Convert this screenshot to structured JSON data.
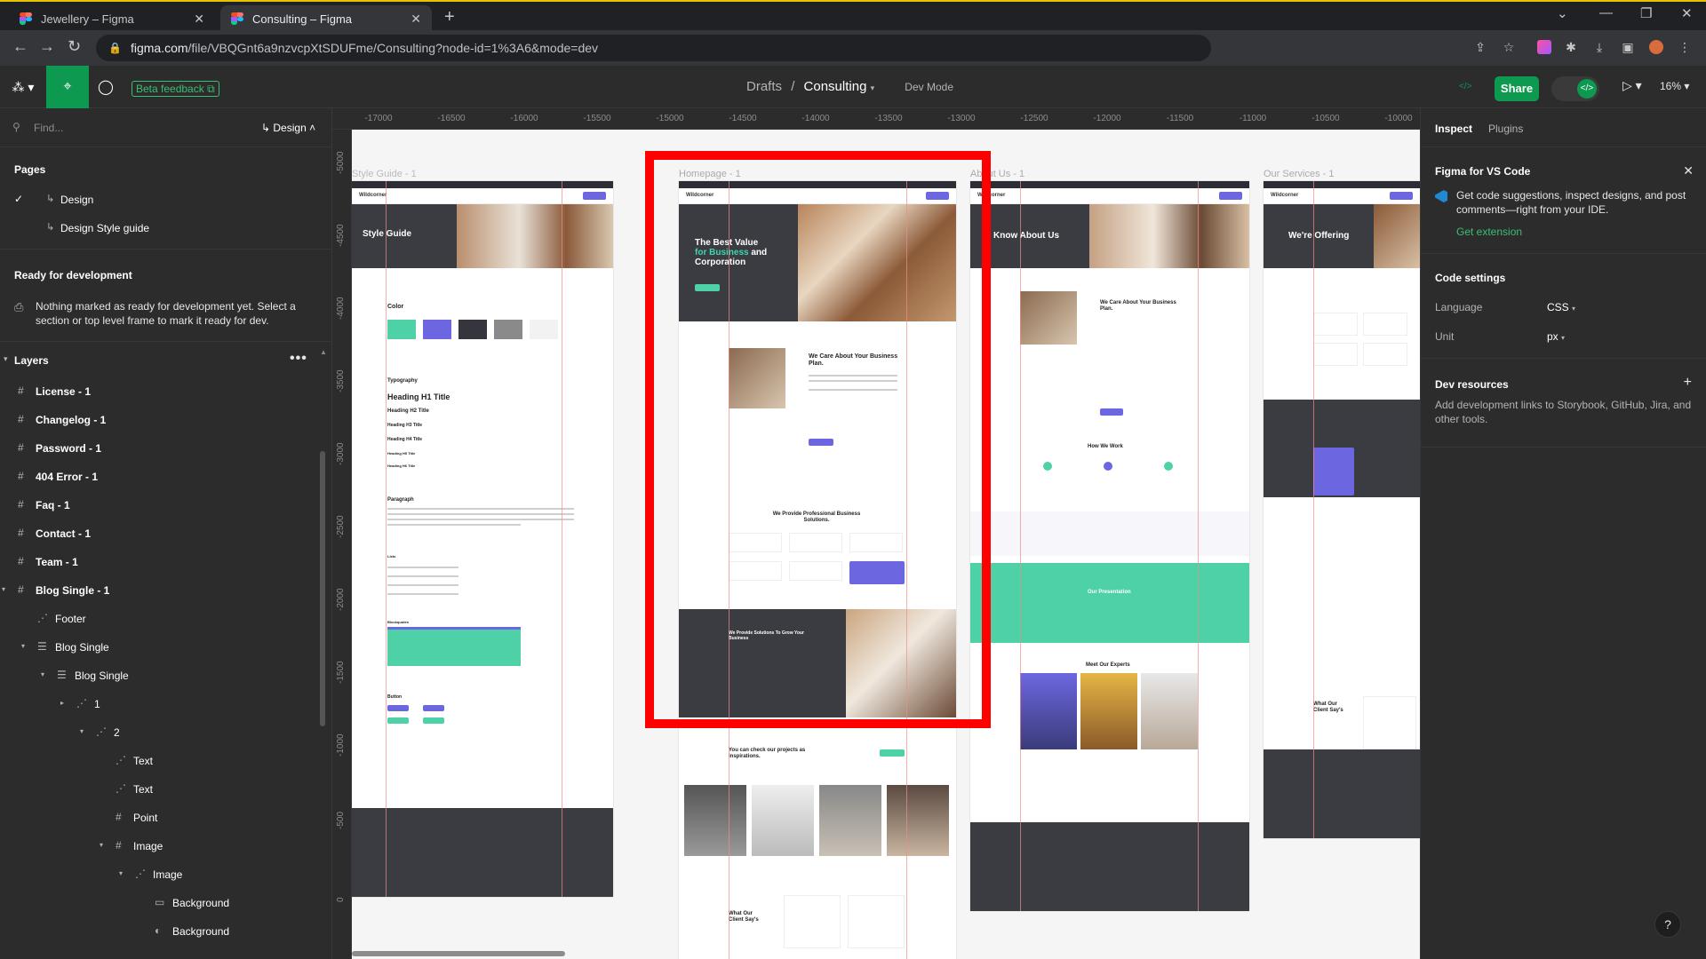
{
  "browser": {
    "tabs": [
      {
        "title": "Jewellery – Figma",
        "active": false
      },
      {
        "title": "Consulting – Figma",
        "active": true
      }
    ],
    "new_tab": "+",
    "url_host": "figma.com",
    "url_path": "/file/VBQGnt6a9nzvcpXtSDUFme/Consulting?node-id=1%3A6&mode=dev"
  },
  "toolbar": {
    "beta_feedback": "Beta feedback",
    "breadcrumb_root": "Drafts",
    "breadcrumb_sep": "/",
    "breadcrumb_file": "Consulting",
    "dev_mode": "Dev Mode",
    "share": "Share",
    "zoom": "16%",
    "avatar_count": "</>"
  },
  "left_panel": {
    "find_placeholder": "Find...",
    "design_label": "Design",
    "pages_heading": "Pages",
    "pages": [
      {
        "label": "Design",
        "selected": true
      },
      {
        "label": "Design Style guide",
        "selected": false
      }
    ],
    "ready_heading": "Ready for development",
    "ready_message": "Nothing marked as ready for development yet. Select a section or top level frame to mark it ready for dev.",
    "layers_heading": "Layers",
    "layers": [
      {
        "label": "License - 1",
        "indent": 0,
        "kind": "frame",
        "caret": ""
      },
      {
        "label": "Changelog - 1",
        "indent": 0,
        "kind": "frame",
        "caret": ""
      },
      {
        "label": "Password - 1",
        "indent": 0,
        "kind": "frame",
        "caret": ""
      },
      {
        "label": "404 Error - 1",
        "indent": 0,
        "kind": "frame",
        "caret": ""
      },
      {
        "label": "Faq - 1",
        "indent": 0,
        "kind": "frame",
        "caret": ""
      },
      {
        "label": "Contact - 1",
        "indent": 0,
        "kind": "frame",
        "caret": ""
      },
      {
        "label": "Team - 1",
        "indent": 0,
        "kind": "frame",
        "caret": ""
      },
      {
        "label": "Blog Single - 1",
        "indent": 0,
        "kind": "frame",
        "caret": "▾"
      },
      {
        "label": "Footer",
        "indent": 1,
        "kind": "group",
        "caret": ""
      },
      {
        "label": "Blog Single",
        "indent": 1,
        "kind": "auto",
        "caret": "▾"
      },
      {
        "label": "Blog Single",
        "indent": 2,
        "kind": "auto",
        "caret": "▾"
      },
      {
        "label": "1",
        "indent": 3,
        "kind": "group",
        "caret": "▸"
      },
      {
        "label": "2",
        "indent": 4,
        "kind": "group",
        "caret": "▾"
      },
      {
        "label": "Text",
        "indent": 5,
        "kind": "group",
        "caret": ""
      },
      {
        "label": "Text",
        "indent": 5,
        "kind": "group",
        "caret": ""
      },
      {
        "label": "Point",
        "indent": 5,
        "kind": "frame",
        "caret": ""
      },
      {
        "label": "Image",
        "indent": 5,
        "kind": "frame",
        "caret": "▾"
      },
      {
        "label": "Image",
        "indent": 6,
        "kind": "group",
        "caret": "▾"
      },
      {
        "label": "Background",
        "indent": 7,
        "kind": "rect",
        "caret": ""
      },
      {
        "label": "Background",
        "indent": 7,
        "kind": "ellipse",
        "caret": ""
      }
    ]
  },
  "rulers": {
    "x": [
      "-17000",
      "-16500",
      "-16000",
      "-15500",
      "-15000",
      "-14500",
      "-14000",
      "-13500",
      "-13000",
      "-12500",
      "-12000",
      "-11500",
      "-11000",
      "-10500",
      "-10000"
    ],
    "y": [
      "-5000",
      "-4500",
      "-4000",
      "-3500",
      "-3000",
      "-2500",
      "-2000",
      "-1500",
      "-1000",
      "-500",
      "0"
    ]
  },
  "canvas": {
    "frame_labels": [
      "Style Guide - 1",
      "Homepage - 1",
      "About Us - 1",
      "Our Services - 1"
    ],
    "style_guide": {
      "hero_title": "Style Guide",
      "color": "Color",
      "typography": "Typography",
      "h1": "Heading H1 Title",
      "h2": "Heading H2 Title",
      "h3": "Heading H3 Title",
      "h4": "Heading H4 Title",
      "h5": "Heading H5 Title",
      "h6": "Heading H6 Title",
      "paragraph": "Paragraph",
      "lists": "Lists",
      "blockquotes": "Blockquotes",
      "button": "Button",
      "swatches": [
        "#4fd1a8",
        "#6c67e0",
        "#35353d",
        "#8a8a8a",
        "#f2f2f2"
      ]
    },
    "homepage": {
      "hero_line1": "The Best Value",
      "hero_accent": "for Business",
      "hero_line2": "and",
      "hero_line3": "Corporation",
      "care_title": "We Care About Your Business Plan.",
      "solutions_title": "We Provide Professional Business Solutions.",
      "solutions2_title": "We Provide Solutions To Grow Your Business",
      "projects_title": "You can check our projects as inspirations.",
      "client_title": "What Our Client Say's"
    },
    "about": {
      "hero_title": "Know About Us",
      "care_title": "We Care About Your Business Plan.",
      "how_title": "How We Work",
      "presentation": "Our Presentation",
      "experts": "Meet Our Experts"
    },
    "services": {
      "hero_title": "We're Offering",
      "client_title": "What Our Client Say's"
    }
  },
  "right_panel": {
    "tab_inspect": "Inspect",
    "tab_plugins": "Plugins",
    "vscode_heading": "Figma for VS Code",
    "vscode_body": "Get code suggestions, inspect designs, and post comments—right from your IDE.",
    "vscode_link": "Get extension",
    "code_settings": "Code settings",
    "language_label": "Language",
    "language_value": "CSS",
    "unit_label": "Unit",
    "unit_value": "px",
    "dev_resources": "Dev resources",
    "dev_resources_body": "Add development links to Storybook, GitHub, Jira, and other tools."
  },
  "help": "?"
}
